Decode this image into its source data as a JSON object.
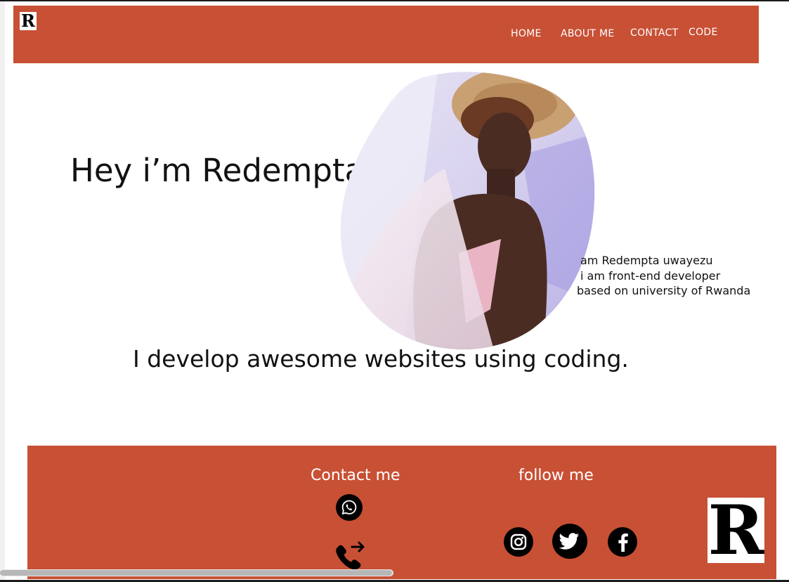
{
  "brand": {
    "logo_letter": "R"
  },
  "nav": {
    "items": [
      {
        "label": "HOME"
      },
      {
        "label": "ABOUT ME"
      },
      {
        "label": "CONTACT"
      },
      {
        "label": "CODE"
      }
    ]
  },
  "hero": {
    "title": "Hey i’m Redempta",
    "bio": [
      "am Redempta uwayezu",
      "i am front-end developer",
      "based on university of Rwanda"
    ],
    "tagline": "I develop awesome websites using coding."
  },
  "footer": {
    "contact_heading": "Contact me",
    "follow_heading": "follow me",
    "contact_icons": [
      "whatsapp-icon",
      "phone-forward-icon"
    ],
    "social_icons": [
      "instagram-icon",
      "twitter-icon",
      "facebook-icon"
    ],
    "logo_letter": "R"
  },
  "colors": {
    "accent": "#c85035",
    "text": "#111111",
    "on_accent": "#ffffff"
  }
}
